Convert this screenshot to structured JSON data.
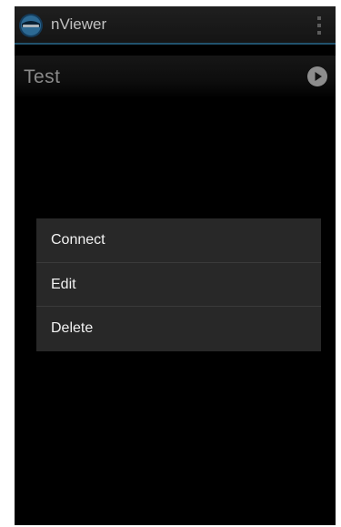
{
  "app": {
    "title": "nViewer",
    "icon": "nviewer-logo-icon",
    "overflow_icon": "overflow-menu-icon"
  },
  "list": {
    "items": [
      {
        "label": "Test",
        "action_icon": "play-icon"
      }
    ]
  },
  "context_menu": {
    "items": [
      {
        "label": "Connect"
      },
      {
        "label": "Edit"
      },
      {
        "label": "Delete"
      }
    ]
  },
  "colors": {
    "action_bar_accent": "#2d6e92",
    "menu_background": "#282828",
    "screen_background": "#000000"
  }
}
